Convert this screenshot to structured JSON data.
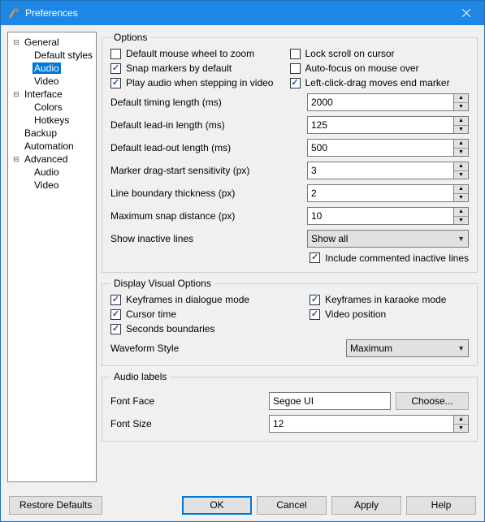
{
  "window": {
    "title": "Preferences"
  },
  "tree": {
    "general": "General",
    "default_styles": "Default styles",
    "audio": "Audio",
    "video": "Video",
    "interface": "Interface",
    "colors": "Colors",
    "hotkeys": "Hotkeys",
    "backup": "Backup",
    "automation": "Automation",
    "advanced": "Advanced",
    "adv_audio": "Audio",
    "adv_video": "Video"
  },
  "options": {
    "legend": "Options",
    "default_mouse_wheel": "Default mouse wheel to zoom",
    "lock_scroll": "Lock scroll on cursor",
    "snap_markers": "Snap markers by default",
    "auto_focus": "Auto-focus on mouse over",
    "play_audio_step": "Play audio when stepping in video",
    "left_click_drag": "Left-click-drag moves end marker",
    "timing_length_label": "Default timing length (ms)",
    "timing_length_value": "2000",
    "lead_in_label": "Default lead-in length (ms)",
    "lead_in_value": "125",
    "lead_out_label": "Default lead-out length (ms)",
    "lead_out_value": "500",
    "marker_drag_label": "Marker drag-start sensitivity (px)",
    "marker_drag_value": "3",
    "line_boundary_label": "Line boundary thickness (px)",
    "line_boundary_value": "2",
    "max_snap_label": "Maximum snap distance (px)",
    "max_snap_value": "10",
    "show_inactive_label": "Show inactive lines",
    "show_inactive_value": "Show all",
    "include_commented": "Include commented inactive lines"
  },
  "display": {
    "legend": "Display Visual Options",
    "keyframes_dialogue": "Keyframes in dialogue mode",
    "keyframes_karaoke": "Keyframes in karaoke mode",
    "cursor_time": "Cursor time",
    "video_position": "Video position",
    "seconds_boundaries": "Seconds boundaries",
    "waveform_label": "Waveform Style",
    "waveform_value": "Maximum"
  },
  "labels": {
    "legend": "Audio labels",
    "font_face_label": "Font Face",
    "font_face_value": "Segoe UI",
    "choose": "Choose...",
    "font_size_label": "Font Size",
    "font_size_value": "12"
  },
  "buttons": {
    "restore": "Restore Defaults",
    "ok": "OK",
    "cancel": "Cancel",
    "apply": "Apply",
    "help": "Help"
  }
}
